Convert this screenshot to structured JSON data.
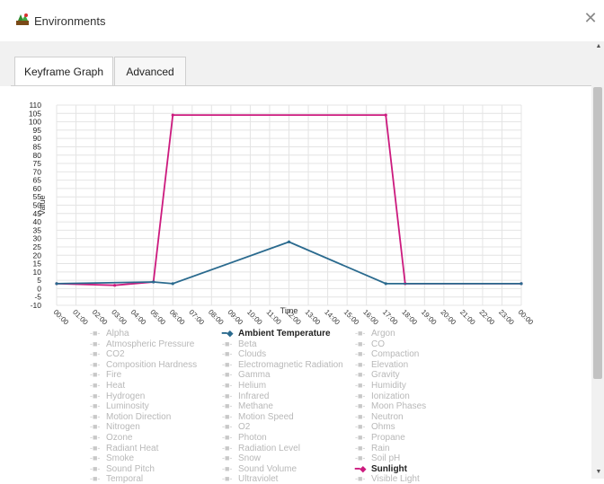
{
  "window": {
    "title": "Environments",
    "close_glyph": "✕"
  },
  "tabs": [
    {
      "label": "Keyframe Graph",
      "active": true
    },
    {
      "label": "Advanced",
      "active": false
    }
  ],
  "chart_data": {
    "type": "line",
    "xlabel": "Time",
    "ylabel": "Value",
    "ylim": [
      -10,
      110
    ],
    "yticks": [
      110,
      105,
      100,
      95,
      90,
      85,
      80,
      75,
      70,
      65,
      60,
      55,
      50,
      45,
      40,
      35,
      30,
      25,
      20,
      15,
      10,
      5,
      0,
      -5,
      -10
    ],
    "xticks": [
      "00:00",
      "01:00",
      "02:00",
      "03:00",
      "04:00",
      "05:00",
      "06:00",
      "07:00",
      "08:00",
      "09:00",
      "10:00",
      "11:00",
      "12:00",
      "13:00",
      "14:00",
      "15:00",
      "16:00",
      "17:00",
      "18:00",
      "19:00",
      "20:00",
      "21:00",
      "22:00",
      "23:00",
      "00:00"
    ],
    "grid": true,
    "series": [
      {
        "name": "Sunlight",
        "color": "#cc1a7e",
        "points": [
          [
            0,
            3
          ],
          [
            3,
            2
          ],
          [
            5,
            4
          ],
          [
            6,
            104
          ],
          [
            17,
            104
          ],
          [
            18,
            3
          ],
          [
            24,
            3
          ]
        ]
      },
      {
        "name": "Ambient Temperature",
        "color": "#2a6a8e",
        "points": [
          [
            0,
            3
          ],
          [
            5,
            4
          ],
          [
            6,
            3
          ],
          [
            12,
            28
          ],
          [
            17,
            3
          ],
          [
            24,
            3
          ]
        ]
      }
    ]
  },
  "legend": {
    "col1": [
      "Alpha",
      "Atmospheric Pressure",
      "CO2",
      "Composition Hardness",
      "Fire",
      "Heat",
      "Hydrogen",
      "Luminosity",
      "Motion Direction",
      "Nitrogen",
      "Ozone",
      "Radiant Heat",
      "Smoke",
      "Sound Pitch",
      "Temporal"
    ],
    "col2": [
      "Ambient Temperature",
      "Beta",
      "Clouds",
      "Electromagnetic Radiation",
      "Gamma",
      "Helium",
      "Infrared",
      "Methane",
      "Motion Speed",
      "O2",
      "Photon",
      "Radiation Level",
      "Snow",
      "Sound Volume",
      "Ultraviolet"
    ],
    "col3": [
      "Argon",
      "CO",
      "Compaction",
      "Elevation",
      "Gravity",
      "Humidity",
      "Ionization",
      "Moon Phases",
      "Neutron",
      "Ohms",
      "Propane",
      "Rain",
      "Soil pH",
      "Sunlight",
      "Visible Light"
    ],
    "active": [
      "Ambient Temperature",
      "Sunlight"
    ]
  }
}
